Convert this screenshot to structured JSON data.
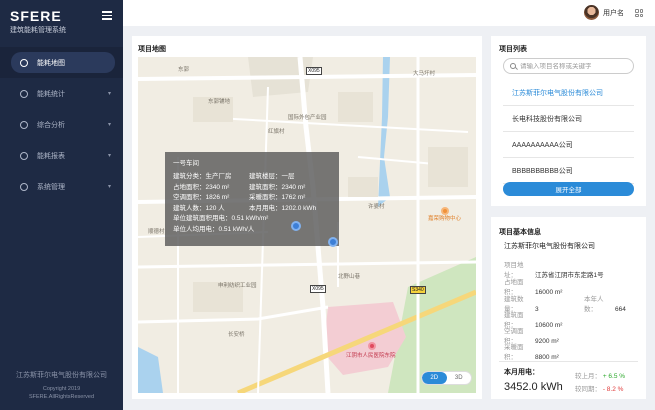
{
  "sidebar": {
    "brand_title": "SFERE",
    "brand_subtitle": "建筑能耗管理系统",
    "items": [
      {
        "label": "能耗地图"
      },
      {
        "label": "能耗统计"
      },
      {
        "label": "综合分析"
      },
      {
        "label": "能耗报表"
      },
      {
        "label": "系统管理"
      }
    ],
    "footer_company": "江苏斯菲尔电气股份有限公司",
    "footer_copyright": "Copyright 2019",
    "footer_rights": "SFERE.AllRightsReserved"
  },
  "header": {
    "username": "用户名"
  },
  "map_panel": {
    "title": "项目地图",
    "labels": {
      "road_shield_1": "X095",
      "road_shield_2": "X095",
      "road_shield_3": "S340",
      "l1": "东郭",
      "l2": "大马圩村",
      "l3": "国际外包产业园",
      "l4": "红旗村",
      "l5": "东郭",
      "l6": "许婆村",
      "l7": "嘉荣购物中心",
      "l8": "北野山巷",
      "l9": "申利纺织工业园",
      "l10": "长安桥",
      "l11": "江阴市人民医院东院",
      "l12": "顺德村",
      "l13": "东郭铺地"
    },
    "popup": {
      "name": "一号车间",
      "rows": [
        {
          "a": "建筑分类：生产厂房",
          "b": "建筑楼层：一层"
        },
        {
          "a": "占地面积：2340 m²",
          "b": "建筑面积：2340 m²"
        },
        {
          "a": "空调面积：1826 m²",
          "b": "采暖面积：1762 m²"
        },
        {
          "a": "建筑人数：120 人",
          "b": "本月用电：1202.0 kWh"
        }
      ],
      "line5": "单位建筑面积用电：0.51 kWh/m²",
      "line6": "单位人均用电：0.51 kWh/人"
    },
    "view_toggle": {
      "opt_2d": "2D",
      "opt_3d": "3D",
      "selected": "2D"
    }
  },
  "project_list": {
    "title": "项目列表",
    "search_placeholder": "请输入项目名称或关键字",
    "items": [
      {
        "name": "江苏斯菲尔电气股份有限公司",
        "selected": true
      },
      {
        "name": "长电科技股份有限公司",
        "selected": false
      },
      {
        "name": "AAAAAAAAAA公司",
        "selected": false
      },
      {
        "name": "BBBBBBBBBB公司",
        "selected": false
      }
    ],
    "expand_label": "展开全部"
  },
  "project_info": {
    "title": "项目基本信息",
    "name": "江苏斯菲尔电气股份有限公司",
    "address_k": "项目地址：",
    "address_v": "江苏省江阴市东定路1号",
    "land_area_k": "占地面积：",
    "land_area_v": "16000 m²",
    "building_count_k": "建筑数量：",
    "building_count_v": "3",
    "people_k": "本年人数：",
    "people_v": "664",
    "building_area_k": "建筑面积：",
    "building_area_v": "10600 m²",
    "ac_area_k": "空调面积：",
    "ac_area_v": "9200 m²",
    "heat_area_k": "采暖面积：",
    "heat_area_v": "8800 m²",
    "usage_label": "本月用电：",
    "usage_value": "3452.0 kWh",
    "mom_k": "较上月：",
    "mom_v": "+ 6.5 %",
    "yoy_k": "较同期：",
    "yoy_v": "- 8.2 %",
    "colors": {
      "up": "#2aa82a",
      "down": "#e03a3a",
      "accent": "#2b8bd8"
    }
  }
}
